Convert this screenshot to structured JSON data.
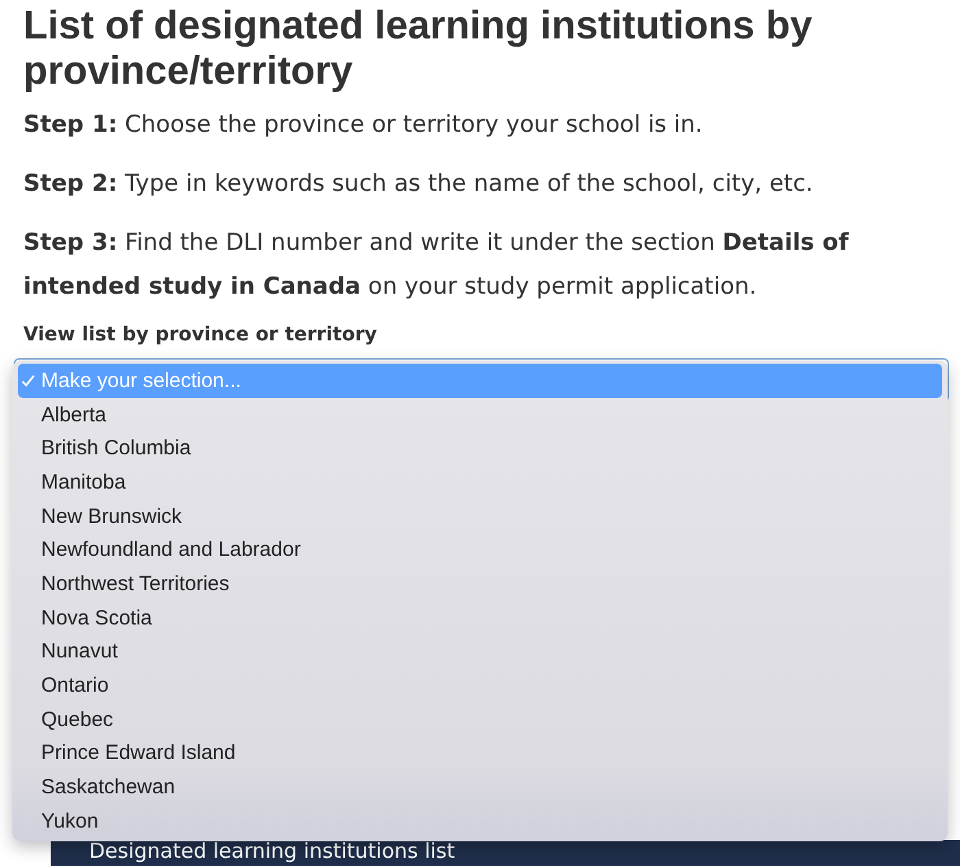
{
  "heading": "List of designated learning institutions by province/territory",
  "steps": [
    {
      "label": "Step 1:",
      "text": "Choose the province or territory your school is in."
    },
    {
      "label": "Step 2:",
      "text": "Type in keywords such as the name of the school, city, etc."
    },
    {
      "label": "Step 3:",
      "text": "Find the DLI number and write it under the section **Details of intended study in Canada** on your study permit application."
    }
  ],
  "select_label": "View list by province or territory",
  "options": [
    {
      "label": "Make your selection...",
      "selected": true
    },
    {
      "label": "Alberta",
      "selected": false
    },
    {
      "label": "British Columbia",
      "selected": false
    },
    {
      "label": "Manitoba",
      "selected": false
    },
    {
      "label": "New Brunswick",
      "selected": false
    },
    {
      "label": "Newfoundland and Labrador",
      "selected": false
    },
    {
      "label": "Northwest Territories",
      "selected": false
    },
    {
      "label": "Nova Scotia",
      "selected": false
    },
    {
      "label": "Nunavut",
      "selected": false
    },
    {
      "label": "Ontario",
      "selected": false
    },
    {
      "label": "Quebec",
      "selected": false
    },
    {
      "label": "Prince Edward Island",
      "selected": false
    },
    {
      "label": "Saskatchewan",
      "selected": false
    },
    {
      "label": "Yukon",
      "selected": false
    }
  ],
  "panel_title": "Designated learning institutions list"
}
